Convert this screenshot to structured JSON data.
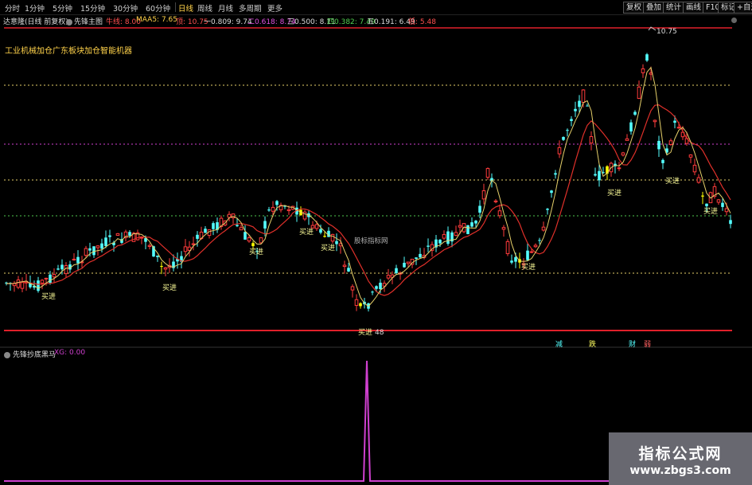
{
  "toolbar": {
    "periods": [
      "分时",
      "1分钟",
      "5分钟",
      "15分钟",
      "30分钟",
      "60分钟",
      "日线",
      "周线",
      "月线",
      "多周期",
      "更多"
    ],
    "active_period": "日线",
    "right_buttons": [
      "复权",
      "叠加",
      "统计",
      "画线",
      "F10",
      "标记",
      "+自选"
    ]
  },
  "infobar": {
    "stock_name": "达意隆(日线 前复权)",
    "indicator": "先锋主图",
    "ma_line": "牛线: 8.00",
    "maa5": "MAA5: 7.65",
    "high": "顶: 10.75",
    "l1": "一0.809: 9.74",
    "l2": "二0.618: 8.74",
    "l3": "三0.500: 8.11",
    "l4": "四0.382: 7.49",
    "l5": "五0.191: 6.49",
    "low": "低: 5.48"
  },
  "stock_title": "工业机械加仓广东板块加仓智能机器",
  "center_watermark": "股标指标网",
  "chart_labels": {
    "peak": "10.75",
    "buy": "买进",
    "bottom_value": "48"
  },
  "signals": [
    "减",
    "跌",
    "财",
    "弱"
  ],
  "indicator_panel": {
    "name": "先锋抄底黑马",
    "value": "XG: 0.00"
  },
  "watermark": {
    "title": "指标公式网",
    "url": "www.zbgs3.com"
  },
  "colors": {
    "up": "#ff3b3b",
    "down": "#54ffff",
    "buy_bar": "#ffff00",
    "ma_red": "#e0302a",
    "ma_yellow": "#e6d06a",
    "purple": "#d040d0",
    "green_dash": "#50c850",
    "yellow_dash": "#e6d06a",
    "support_red": "#e0202a"
  }
}
